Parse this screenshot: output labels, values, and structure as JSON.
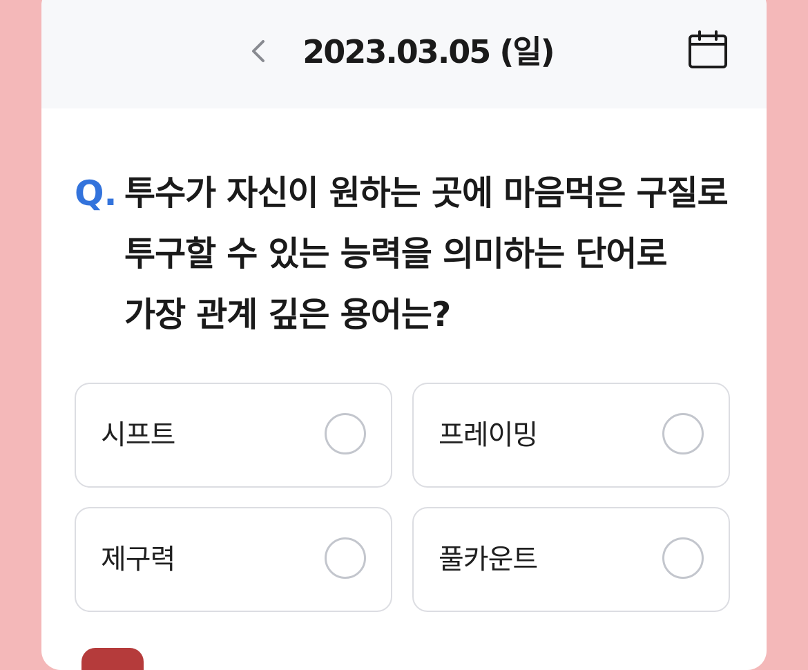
{
  "header": {
    "date": "2023.03.05 (일)",
    "back_icon": "chevron-left-icon",
    "calendar_icon": "calendar-icon"
  },
  "question": {
    "prefix": "Q.",
    "text": "투수가 자신이 원하는 곳에 마음먹은 구질로 투구할 수 있는 능력을 의미하는 단어로 가장 관계 깊은 용어는?"
  },
  "options": [
    {
      "label": "시프트",
      "selected": false
    },
    {
      "label": "프레이밍",
      "selected": false
    },
    {
      "label": "제구력",
      "selected": false
    },
    {
      "label": "풀카운트",
      "selected": false
    }
  ],
  "colors": {
    "background": "#f4b8b9",
    "accent": "#3373dc",
    "header_bg": "#f7f8fa",
    "border": "#dcdde2"
  }
}
